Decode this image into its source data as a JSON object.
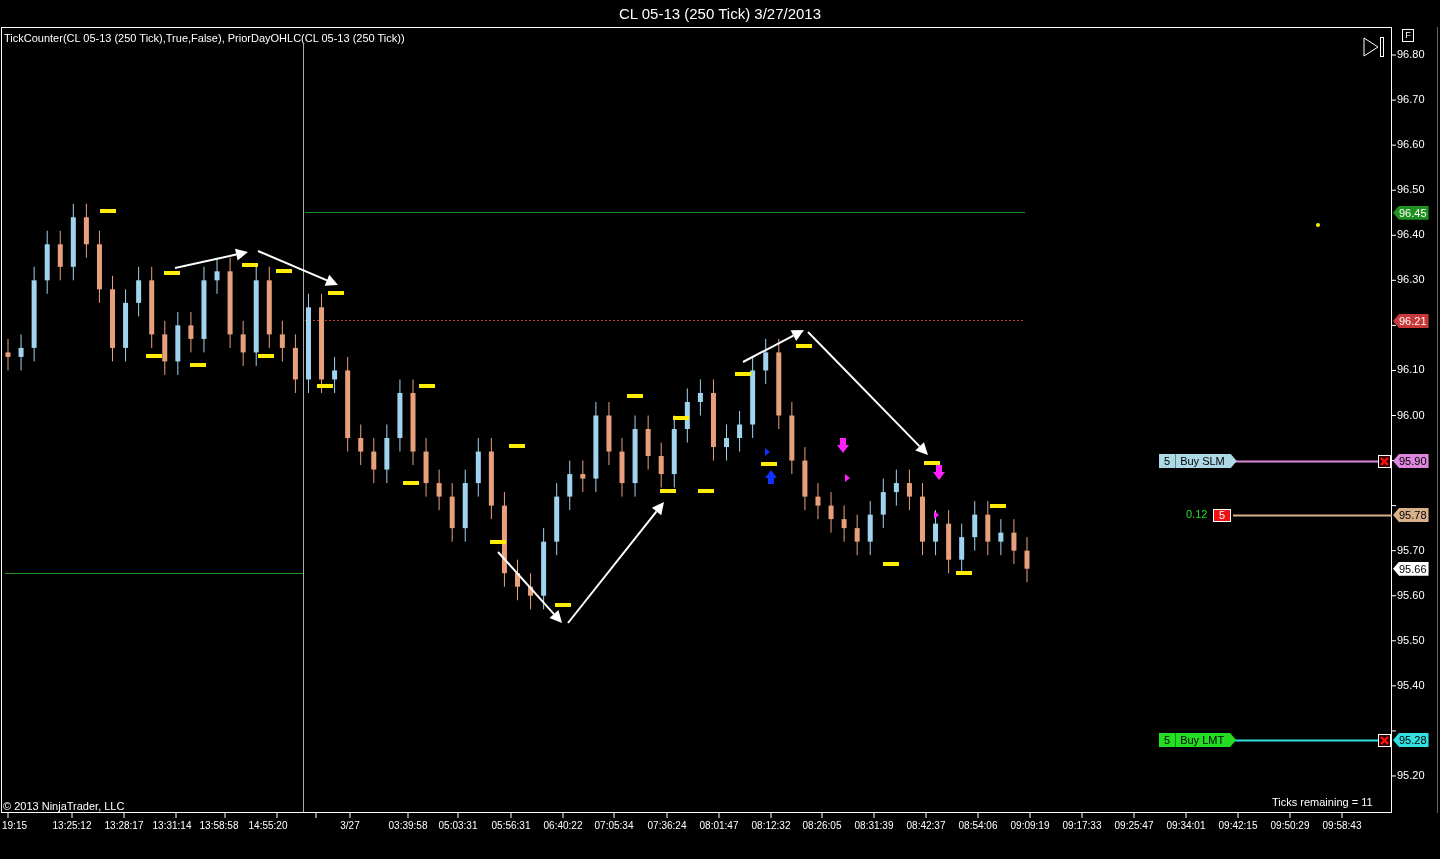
{
  "window": {
    "title": "CL 05-13 (250 Tick)  3/27/2013"
  },
  "indicator_label": "TickCounter(CL 05-13 (250 Tick),True,False), PriorDayOHLC(CL 05-13 (250 Tick))",
  "scale_button": "F",
  "copyright": "© 2013 NinjaTrader, LLC",
  "ticks_remaining": "Ticks remaining = 11",
  "price_axis_labels": [
    "96.80",
    "96.70",
    "96.60",
    "96.50",
    "96.40",
    "96.30",
    "96.10",
    "96.00",
    "95.70",
    "95.60",
    "95.50",
    "95.40",
    "95.20"
  ],
  "time_axis_labels": [
    "19:15",
    "13:25:12",
    "13:28:17",
    "13:31:14",
    "13:58:58",
    "14:55:20",
    "3/27",
    "03:39:58",
    "05:03:31",
    "05:56:31",
    "06:40:22",
    "07:05:34",
    "07:36:24",
    "08:01:47",
    "08:12:32",
    "08:26:05",
    "08:31:39",
    "08:42:37",
    "08:54:06",
    "09:09:19",
    "09:17:33",
    "09:25:47",
    "09:34:01",
    "09:42:15",
    "09:50:29",
    "09:58:43"
  ],
  "price_markers": [
    {
      "label": "96.45",
      "color": "#1f8f1f"
    },
    {
      "label": "96.21",
      "color": "#c83838"
    },
    {
      "label": "95.66",
      "color": "#ffffff"
    }
  ],
  "orders": [
    {
      "kind": "order",
      "quantity": "5",
      "label": "Buy SLM",
      "color": "#add8e6",
      "price_marker": {
        "label": "95.90",
        "color": "#dd88dd"
      }
    },
    {
      "kind": "position",
      "pnl": "0.12",
      "quantity": "5",
      "color": "#ee1111",
      "price_marker": {
        "label": "95.78",
        "color": "#d8b08a"
      }
    },
    {
      "kind": "order",
      "quantity": "5",
      "label": "Buy LMT",
      "color": "#22dd22",
      "price_marker": {
        "label": "95.28",
        "color": "#33e0e0"
      }
    }
  ]
}
